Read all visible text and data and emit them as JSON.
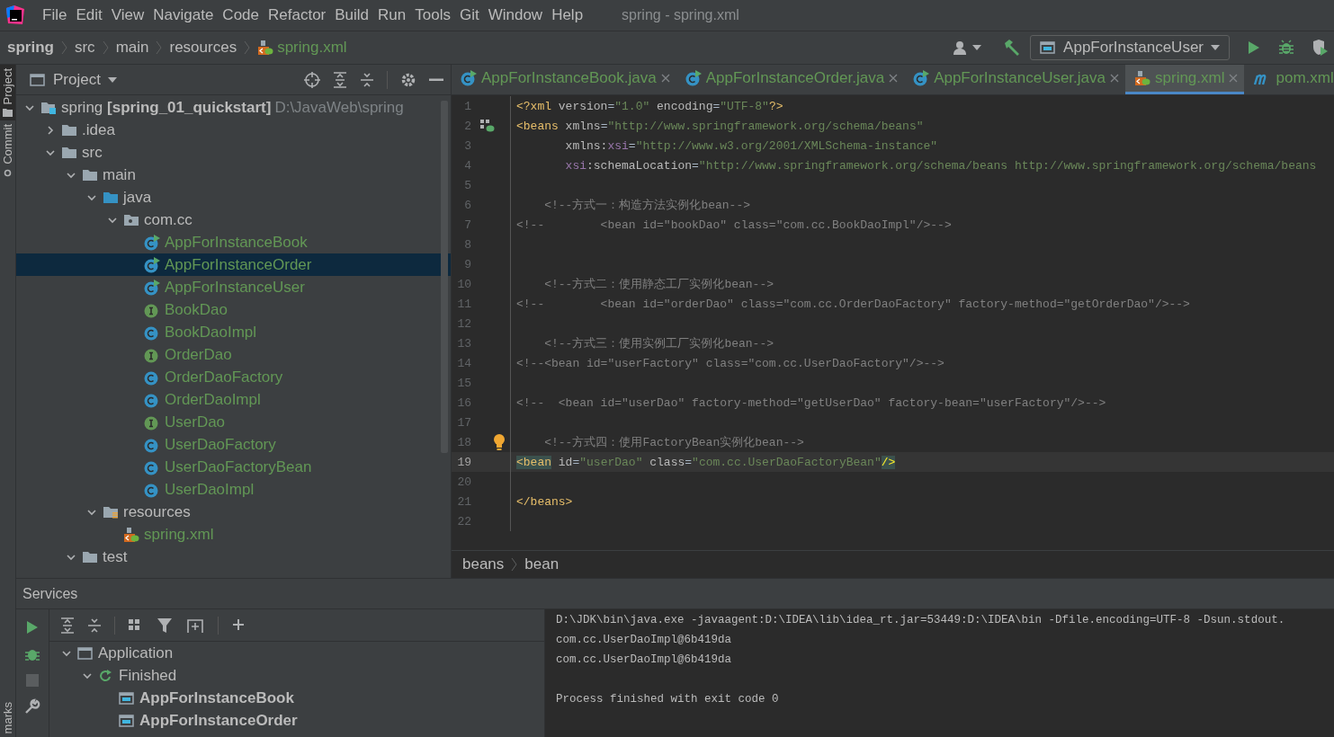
{
  "window": {
    "title": "spring - spring.xml"
  },
  "menu": [
    {
      "label": "File"
    },
    {
      "label": "Edit"
    },
    {
      "label": "View"
    },
    {
      "label": "Navigate"
    },
    {
      "label": "Code"
    },
    {
      "label": "Refactor"
    },
    {
      "label": "Build"
    },
    {
      "label": "Run"
    },
    {
      "label": "Tools"
    },
    {
      "label": "Git"
    },
    {
      "label": "Window"
    },
    {
      "label": "Help"
    }
  ],
  "navbar": {
    "breadcrumbs": [
      {
        "label": "spring",
        "kind": "project"
      },
      {
        "label": "src",
        "kind": "folder"
      },
      {
        "label": "main",
        "kind": "folder"
      },
      {
        "label": "resources",
        "kind": "folder"
      },
      {
        "label": "spring.xml",
        "kind": "xml",
        "color": "#629755"
      }
    ],
    "run_config": "AppForInstanceUser"
  },
  "tool_strip": {
    "items": [
      {
        "label": "Project",
        "selected": true
      },
      {
        "label": "Commit",
        "selected": false
      }
    ],
    "bottom": "marks"
  },
  "project_panel": {
    "title": "Project",
    "tree": [
      {
        "label": "spring",
        "qualifier": "[spring_01_quickstart]",
        "path": "D:\\JavaWeb\\spring",
        "kind": "module",
        "expanded": true,
        "selected": false,
        "children": [
          {
            "label": ".idea",
            "kind": "folder",
            "expanded": false,
            "selected": false
          },
          {
            "label": "src",
            "kind": "folder",
            "expanded": true,
            "selected": false,
            "children": [
              {
                "label": "main",
                "kind": "folder",
                "expanded": true,
                "selected": false,
                "children": [
                  {
                    "label": "java",
                    "kind": "source-folder",
                    "expanded": true,
                    "selected": false,
                    "children": [
                      {
                        "label": "com.cc",
                        "kind": "package",
                        "expanded": true,
                        "selected": false,
                        "children": [
                          {
                            "label": "AppForInstanceBook",
                            "kind": "runnable-class",
                            "color": "#629755",
                            "selected": false
                          },
                          {
                            "label": "AppForInstanceOrder",
                            "kind": "runnable-class",
                            "color": "#629755",
                            "selected": true
                          },
                          {
                            "label": "AppForInstanceUser",
                            "kind": "runnable-class",
                            "color": "#629755",
                            "selected": false
                          },
                          {
                            "label": "BookDao",
                            "kind": "interface",
                            "color": "#629755",
                            "selected": false
                          },
                          {
                            "label": "BookDaoImpl",
                            "kind": "class",
                            "color": "#629755",
                            "selected": false
                          },
                          {
                            "label": "OrderDao",
                            "kind": "interface",
                            "color": "#629755",
                            "selected": false
                          },
                          {
                            "label": "OrderDaoFactory",
                            "kind": "class",
                            "color": "#629755",
                            "selected": false
                          },
                          {
                            "label": "OrderDaoImpl",
                            "kind": "class",
                            "color": "#629755",
                            "selected": false
                          },
                          {
                            "label": "UserDao",
                            "kind": "interface",
                            "color": "#629755",
                            "selected": false
                          },
                          {
                            "label": "UserDaoFactory",
                            "kind": "class",
                            "color": "#629755",
                            "selected": false
                          },
                          {
                            "label": "UserDaoFactoryBean",
                            "kind": "class",
                            "color": "#629755",
                            "selected": false
                          },
                          {
                            "label": "UserDaoImpl",
                            "kind": "class",
                            "color": "#629755",
                            "selected": false
                          }
                        ]
                      }
                    ]
                  },
                  {
                    "label": "resources",
                    "kind": "resource-folder",
                    "expanded": true,
                    "selected": false,
                    "children": [
                      {
                        "label": "spring.xml",
                        "kind": "xml",
                        "color": "#629755",
                        "selected": false
                      }
                    ]
                  }
                ]
              },
              {
                "label": "test",
                "kind": "folder",
                "expanded": true,
                "selected": false
              }
            ]
          }
        ]
      }
    ]
  },
  "editor": {
    "tabs": [
      {
        "label": "AppForInstanceBook.java",
        "kind": "runnable-class",
        "color": "#629755",
        "selected": false,
        "closable": true
      },
      {
        "label": "AppForInstanceOrder.java",
        "kind": "runnable-class",
        "color": "#629755",
        "selected": false,
        "closable": true
      },
      {
        "label": "AppForInstanceUser.java",
        "kind": "runnable-class",
        "color": "#629755",
        "selected": false,
        "closable": true
      },
      {
        "label": "spring.xml",
        "kind": "xml",
        "color": "#629755",
        "selected": true,
        "closable": true
      },
      {
        "label": "pom.xml",
        "kind": "maven",
        "color": "#629755",
        "selected": false,
        "closable": false
      }
    ],
    "lines": [
      {
        "number": "1",
        "current": false,
        "segments": [
          {
            "kind": "tag",
            "text": "<?xml "
          },
          {
            "kind": "attr",
            "text": "version"
          },
          {
            "kind": "text",
            "text": "="
          },
          {
            "kind": "value",
            "text": "\"1.0\" "
          },
          {
            "kind": "attr",
            "text": "encoding"
          },
          {
            "kind": "text",
            "text": "="
          },
          {
            "kind": "value",
            "text": "\"UTF-8\""
          },
          {
            "kind": "tag",
            "text": "?>"
          }
        ]
      },
      {
        "number": "2",
        "current": false,
        "kind": "bean-marker",
        "segments": [
          {
            "kind": "tag",
            "text": "<beans "
          },
          {
            "kind": "attr",
            "text": "xmlns"
          },
          {
            "kind": "text",
            "text": "="
          },
          {
            "kind": "value",
            "text": "\"http://www.springframework.org/schema/beans\""
          }
        ]
      },
      {
        "number": "3",
        "current": false,
        "segments": [
          {
            "kind": "attr",
            "text": "       xmlns:"
          },
          {
            "kind": "ns",
            "text": "xsi"
          },
          {
            "kind": "text",
            "text": "="
          },
          {
            "kind": "value",
            "text": "\"http://www.w3.org/2001/XMLSchema-instance\""
          }
        ]
      },
      {
        "number": "4",
        "current": false,
        "segments": [
          {
            "kind": "ns",
            "text": "       xsi"
          },
          {
            "kind": "attr",
            "text": ":schemaLocation"
          },
          {
            "kind": "text",
            "text": "="
          },
          {
            "kind": "value",
            "text": "\"http://www.springframework.org/schema/beans http://www.springframework.org/schema/beans"
          }
        ]
      },
      {
        "number": "5",
        "current": false
      },
      {
        "number": "6",
        "current": false,
        "segments": [
          {
            "kind": "comment",
            "text": "    <!--方式一：构造方法实例化bean-->"
          }
        ]
      },
      {
        "number": "7",
        "current": false,
        "segments": [
          {
            "kind": "comment",
            "text": "<!--        <bean id=\"bookDao\" class=\"com.cc.BookDaoImpl\"/>-->"
          }
        ]
      },
      {
        "number": "8",
        "current": false
      },
      {
        "number": "9",
        "current": false
      },
      {
        "number": "10",
        "current": false,
        "segments": [
          {
            "kind": "comment",
            "text": "    <!--方式二：使用静态工厂实例化bean-->"
          }
        ]
      },
      {
        "number": "11",
        "current": false,
        "segments": [
          {
            "kind": "comment",
            "text": "<!--        <bean id=\"orderDao\" class=\"com.cc.OrderDaoFactory\" factory-method=\"getOrderDao\"/>-->"
          }
        ]
      },
      {
        "number": "12",
        "current": false
      },
      {
        "number": "13",
        "current": false,
        "segments": [
          {
            "kind": "comment",
            "text": "    <!--方式三：使用实例工厂实例化bean-->"
          }
        ]
      },
      {
        "number": "14",
        "current": false,
        "segments": [
          {
            "kind": "comment",
            "text": "<!--<bean id=\"userFactory\" class=\"com.cc.UserDaoFactory\"/>-->"
          }
        ]
      },
      {
        "number": "15",
        "current": false
      },
      {
        "number": "16",
        "current": false,
        "segments": [
          {
            "kind": "comment",
            "text": "<!--  <bean id=\"userDao\" factory-method=\"getUserDao\" factory-bean=\"userFactory\"/>-->"
          }
        ]
      },
      {
        "number": "17",
        "current": false
      },
      {
        "number": "18",
        "current": false,
        "kind": "bulb-marker",
        "segments": [
          {
            "kind": "comment",
            "text": "    <!--方式四：使用FactoryBean实例化bean-->"
          }
        ]
      },
      {
        "number": "19",
        "current": true,
        "segments": [
          {
            "kind": "match",
            "text": "  <bean"
          },
          {
            "kind": "attr",
            "text": " id"
          },
          {
            "kind": "text",
            "text": "="
          },
          {
            "kind": "value",
            "text": "\"userDao\" "
          },
          {
            "kind": "attr",
            "text": "class"
          },
          {
            "kind": "text",
            "text": "="
          },
          {
            "kind": "value",
            "text": "\"com.cc.UserDaoFactoryBean\""
          },
          {
            "kind": "match",
            "text": "/>"
          }
        ]
      },
      {
        "number": "20",
        "current": false
      },
      {
        "number": "21",
        "current": false,
        "segments": [
          {
            "kind": "tag",
            "text": "</beans>"
          }
        ]
      },
      {
        "number": "22",
        "current": false
      }
    ],
    "breadcrumbs": [
      {
        "label": "beans"
      },
      {
        "label": "bean"
      }
    ]
  },
  "services": {
    "title": "Services",
    "tree": [
      {
        "label": "Application",
        "kind": "app",
        "expanded": true,
        "children": [
          {
            "label": "Finished",
            "kind": "finished",
            "expanded": true,
            "children": [
              {
                "label": "AppForInstanceBook",
                "kind": "run-config"
              },
              {
                "label": "AppForInstanceOrder",
                "kind": "run-config"
              }
            ]
          }
        ]
      }
    ],
    "console": {
      "lines": [
        {
          "text": "D:\\JDK\\bin\\java.exe -javaagent:D:\\IDEA\\lib\\idea_rt.jar=53449:D:\\IDEA\\bin -Dfile.encoding=UTF-8 -Dsun.stdout."
        },
        {
          "text": "com.cc.UserDaoImpl@6b419da"
        },
        {
          "text": "com.cc.UserDaoImpl@6b419da"
        }
      ],
      "exit_message": "Process finished with exit code 0"
    }
  }
}
